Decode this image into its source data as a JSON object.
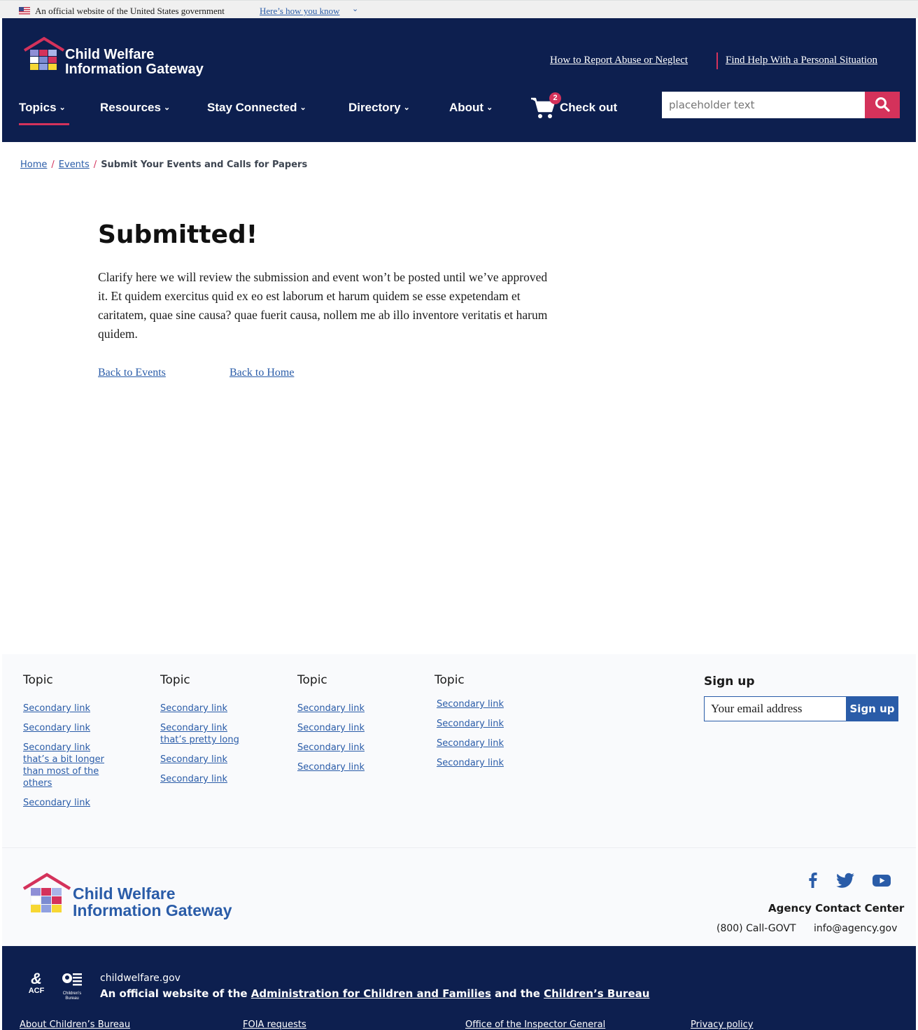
{
  "gov_banner": {
    "text": "An official website of the United States government",
    "link": "Here’s how you know"
  },
  "header": {
    "logo_line1": "Child Welfare",
    "logo_line2": "Information Gateway",
    "util_links": [
      "How to Report Abuse or Neglect",
      "Find Help With a Personal Situation"
    ],
    "nav": [
      {
        "label": "Topics"
      },
      {
        "label": "Resources"
      },
      {
        "label": "Stay Connected"
      },
      {
        "label": "Directory"
      },
      {
        "label": "About"
      }
    ],
    "cart_count": "2",
    "checkout_label": "Check out",
    "search_placeholder": "placeholder text"
  },
  "breadcrumb": {
    "items": [
      "Home",
      "Events"
    ],
    "current": "Submit Your Events and Calls for Papers"
  },
  "main": {
    "title": "Submitted!",
    "body": "Clarify here we will review the submission and event won’t be posted until we’ve approved it. Et quidem exercitus quid ex eo est laborum et harum quidem se esse expetendam et caritatem, quae sine causa? quae fuerit causa, nollem me ab illo inventore veritatis et harum quidem.",
    "links": [
      "Back to Events",
      "Back to Home"
    ]
  },
  "footer": {
    "columns": [
      {
        "heading": "Topic",
        "links": [
          "Secondary link",
          "Secondary link",
          "Secondary link that’s a bit longer than most of the others",
          "Secondary link"
        ]
      },
      {
        "heading": "Topic",
        "links": [
          "Secondary link",
          "Secondary link that’s pretty long",
          "Secondary link",
          "Secondary link"
        ]
      },
      {
        "heading": "Topic",
        "links": [
          "Secondary link",
          "Secondary link",
          "Secondary link",
          "Secondary link"
        ]
      },
      {
        "heading": "Topic",
        "links": [
          "Secondary link",
          "Secondary link",
          "Secondary link",
          "Secondary link"
        ]
      }
    ],
    "signup": {
      "title": "Sign up",
      "placeholder": "Your email address",
      "button": "Sign up"
    },
    "logo_line1": "Child Welfare",
    "logo_line2": "Information Gateway",
    "social": [
      "facebook-icon",
      "twitter-icon",
      "youtube-icon"
    ],
    "contact": {
      "title": "Agency Contact Center",
      "phone": "(800) Call-GOVT",
      "email": "info@agency.gov"
    }
  },
  "bottom_bar": {
    "acf_label": "ACF",
    "cb_label": "Children’s Bureau",
    "domain": "childwelfare.gov",
    "official_prefix": "An official website of the ",
    "acf_link": "Administration for Children and Families",
    "official_and": " and the ",
    "cb_link": "Children’s Bureau",
    "links": [
      "About Children’s Bureau",
      "FOIA requests",
      "Office of the Inspector General",
      "Privacy policy"
    ]
  },
  "colors": {
    "navy": "#0d1f4f",
    "accent": "#d4325b",
    "link": "#2a5ca8"
  }
}
